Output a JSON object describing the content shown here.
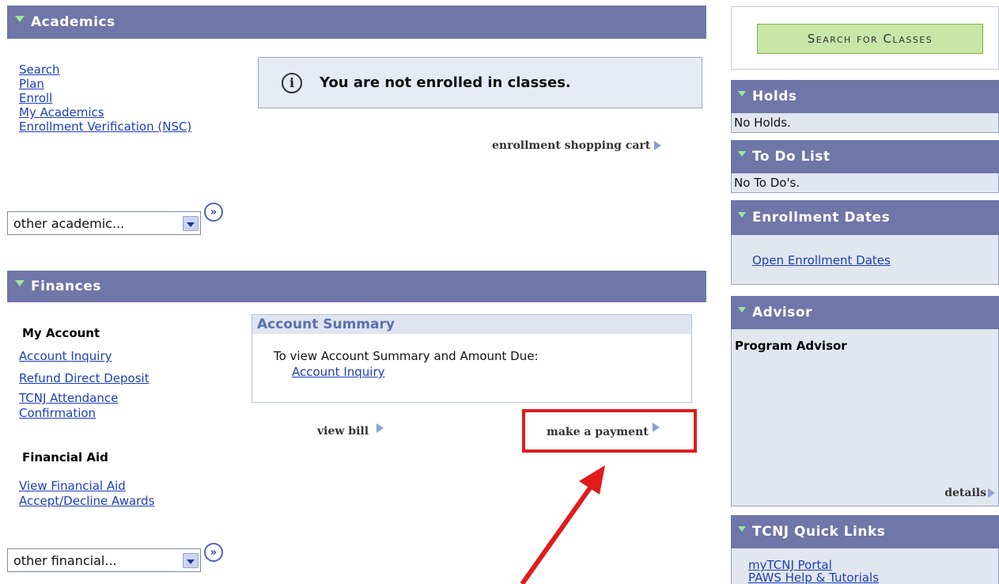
{
  "academics": {
    "header": "Academics",
    "links": [
      "Search",
      "Plan",
      "Enroll",
      "My Academics",
      "Enrollment Verification (NSC)"
    ],
    "info_message": "You are not enrolled in classes.",
    "info_icon": "info-icon",
    "cart_link": "enrollment shopping cart",
    "dropdown_value": "other academic..."
  },
  "finances": {
    "header": "Finances",
    "my_account_label": "My Account",
    "account_links": [
      "Account Inquiry",
      "Refund Direct Deposit",
      "TCNJ Attendance",
      "Confirmation"
    ],
    "financial_aid_label": "Financial Aid",
    "aid_links": [
      "View Financial Aid",
      "Accept/Decline Awards"
    ],
    "dropdown_value": "other financial...",
    "summary": {
      "title": "Account Summary",
      "text": "To view Account Summary and Amount Due:",
      "link": "Account Inquiry"
    },
    "view_bill": "view bill",
    "make_payment": "make a payment"
  },
  "right": {
    "search_button": "Search for Classes",
    "holds": {
      "header": "Holds",
      "text": "No Holds."
    },
    "todo": {
      "header": "To Do List",
      "text": "No To Do's."
    },
    "enrollment_dates": {
      "header": "Enrollment Dates",
      "link": "Open Enrollment Dates"
    },
    "advisor": {
      "header": "Advisor",
      "label": "Program Advisor",
      "details": "details"
    },
    "quick_links": {
      "header": "TCNJ Quick Links",
      "links": [
        "myTCNJ Portal",
        "PAWS Help & Tutorials"
      ]
    }
  },
  "annotation": {
    "highlight_color": "#e21b1b"
  }
}
